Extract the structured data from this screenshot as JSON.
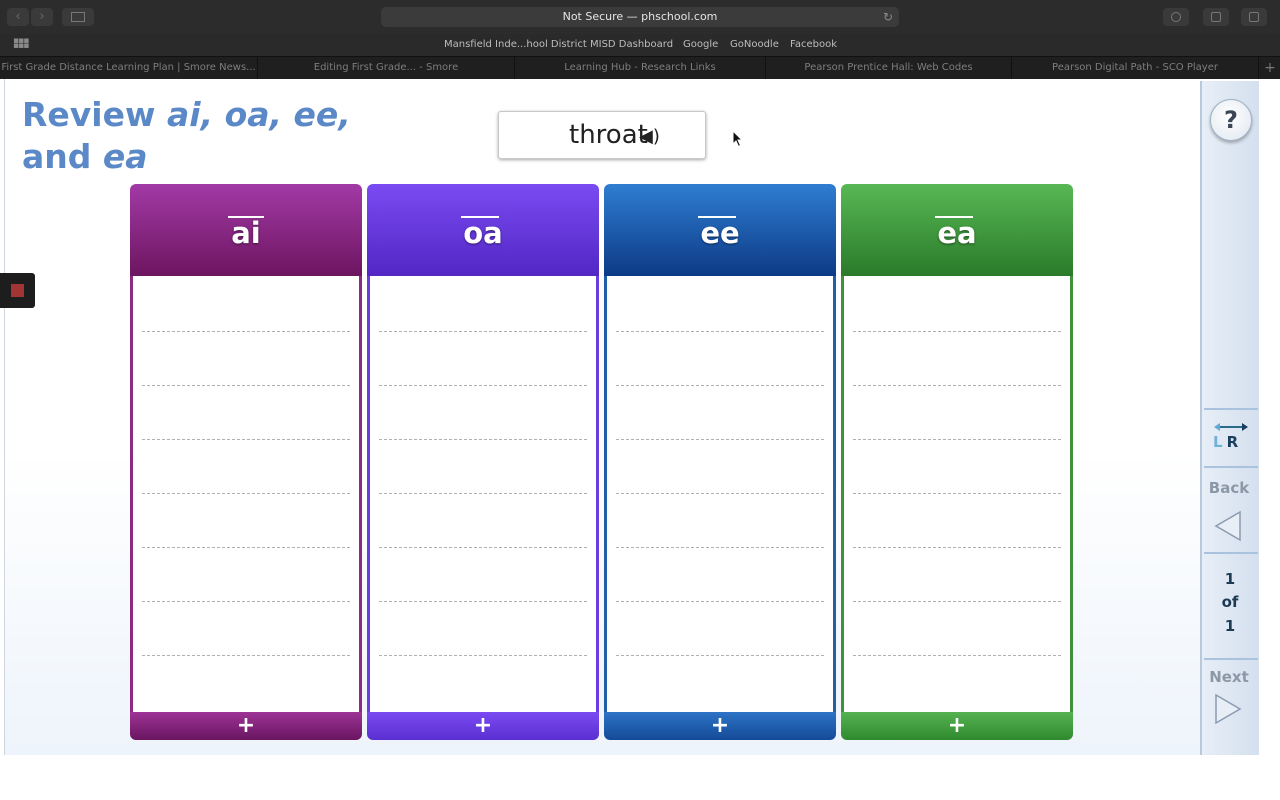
{
  "browser": {
    "address": "Not Secure — phschool.com",
    "bookmarks": [
      "Mansfield Inde...hool District",
      "MISD Dashboard",
      "Google",
      "GoNoodle",
      "Facebook"
    ],
    "tabs": [
      "First Grade Distance Learning Plan | Smore News...",
      "Editing First Grade... - Smore",
      "Learning Hub - Research Links",
      "Pearson Prentice Hall: Web Codes",
      "Pearson Digital Path - SCO Player"
    ],
    "new_tab": "+"
  },
  "activity": {
    "title_line1_prefix": "Review ",
    "title_line1_em": "ai, oa, ee,",
    "title_line2_prefix": "and ",
    "title_line2_em": "ea",
    "word": "throat",
    "speaker_icon": "speaker-icon"
  },
  "columns": [
    {
      "label": "ai",
      "color": "#8c2a83",
      "add": "+"
    },
    {
      "label": "oa",
      "color": "#6a3de0",
      "add": "+"
    },
    {
      "label": "ee",
      "color": "#235fa9",
      "add": "+"
    },
    {
      "label": "ea",
      "color": "#3f913d",
      "add": "+"
    }
  ],
  "panel": {
    "help": "?",
    "lr_left": "L",
    "lr_right": "R",
    "back": "Back",
    "next": "Next",
    "page_current": "1",
    "page_of": "of",
    "page_total": "1"
  }
}
